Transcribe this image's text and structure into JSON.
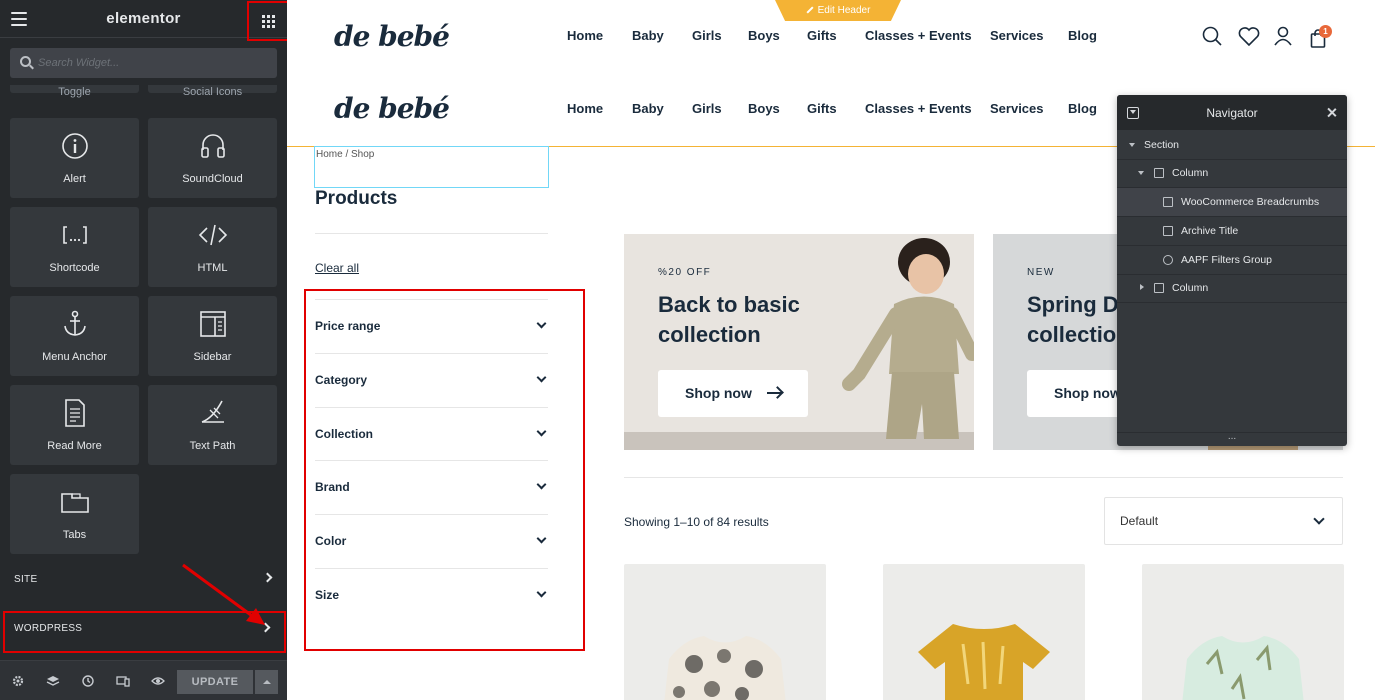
{
  "panel": {
    "logo": "elementor",
    "search_placeholder": "Search Widget...",
    "widgets_partial": [
      "Toggle",
      "Social Icons"
    ],
    "widgets": [
      {
        "label": "Alert",
        "icon": "info-circle-icon"
      },
      {
        "label": "SoundCloud",
        "icon": "headphones-icon"
      },
      {
        "label": "Shortcode",
        "icon": "shortcode-icon"
      },
      {
        "label": "HTML",
        "icon": "code-icon"
      },
      {
        "label": "Menu Anchor",
        "icon": "anchor-icon"
      },
      {
        "label": "Sidebar",
        "icon": "sidebar-icon"
      },
      {
        "label": "Read More",
        "icon": "document-icon"
      },
      {
        "label": "Text Path",
        "icon": "text-path-icon"
      },
      {
        "label": "Tabs",
        "icon": "tabs-icon"
      }
    ],
    "sections": [
      {
        "label": "SITE"
      },
      {
        "label": "WORDPRESS"
      }
    ],
    "footer": {
      "update_label": "UPDATE",
      "icons": [
        "settings-icon",
        "layers-icon",
        "history-icon",
        "responsive-icon",
        "preview-eye-icon"
      ]
    }
  },
  "site": {
    "brand": "de bebé",
    "edit_header_label": "Edit Header",
    "nav": [
      "Home",
      "Baby",
      "Girls",
      "Boys",
      "Gifts",
      "Classes + Events",
      "Services",
      "Blog"
    ],
    "cart_count": "1",
    "breadcrumb": "Home / Shop",
    "archive_title": "Products",
    "clear_all": "Clear all",
    "filters": [
      "Price range",
      "Category",
      "Collection",
      "Brand",
      "Color",
      "Size"
    ],
    "banners": [
      {
        "tag": "%20 OFF",
        "title_line1": "Back to basic",
        "title_line2": "collection",
        "button": "Shop now"
      },
      {
        "tag": "NEW",
        "title_line1": "Spring Dr",
        "title_line2": "collection",
        "button": "Shop now"
      }
    ],
    "results_text": "Showing 1–10 of 84 results",
    "sort_value": "Default"
  },
  "navigator": {
    "title": "Navigator",
    "items": [
      {
        "label": "Section"
      },
      {
        "label": "Column"
      },
      {
        "label": "WooCommerce Breadcrumbs"
      },
      {
        "label": "Archive Title"
      },
      {
        "label": "AAPF Filters Group"
      },
      {
        "label": "Column"
      }
    ],
    "footer": "..."
  },
  "colors": {
    "panel_bg": "#26292c",
    "widget_bg": "#34383c",
    "highlight_red": "#e10000",
    "accent_yellow": "#f4b335",
    "brand_navy": "#1a2b3c",
    "cart_badge": "#e8683a"
  }
}
